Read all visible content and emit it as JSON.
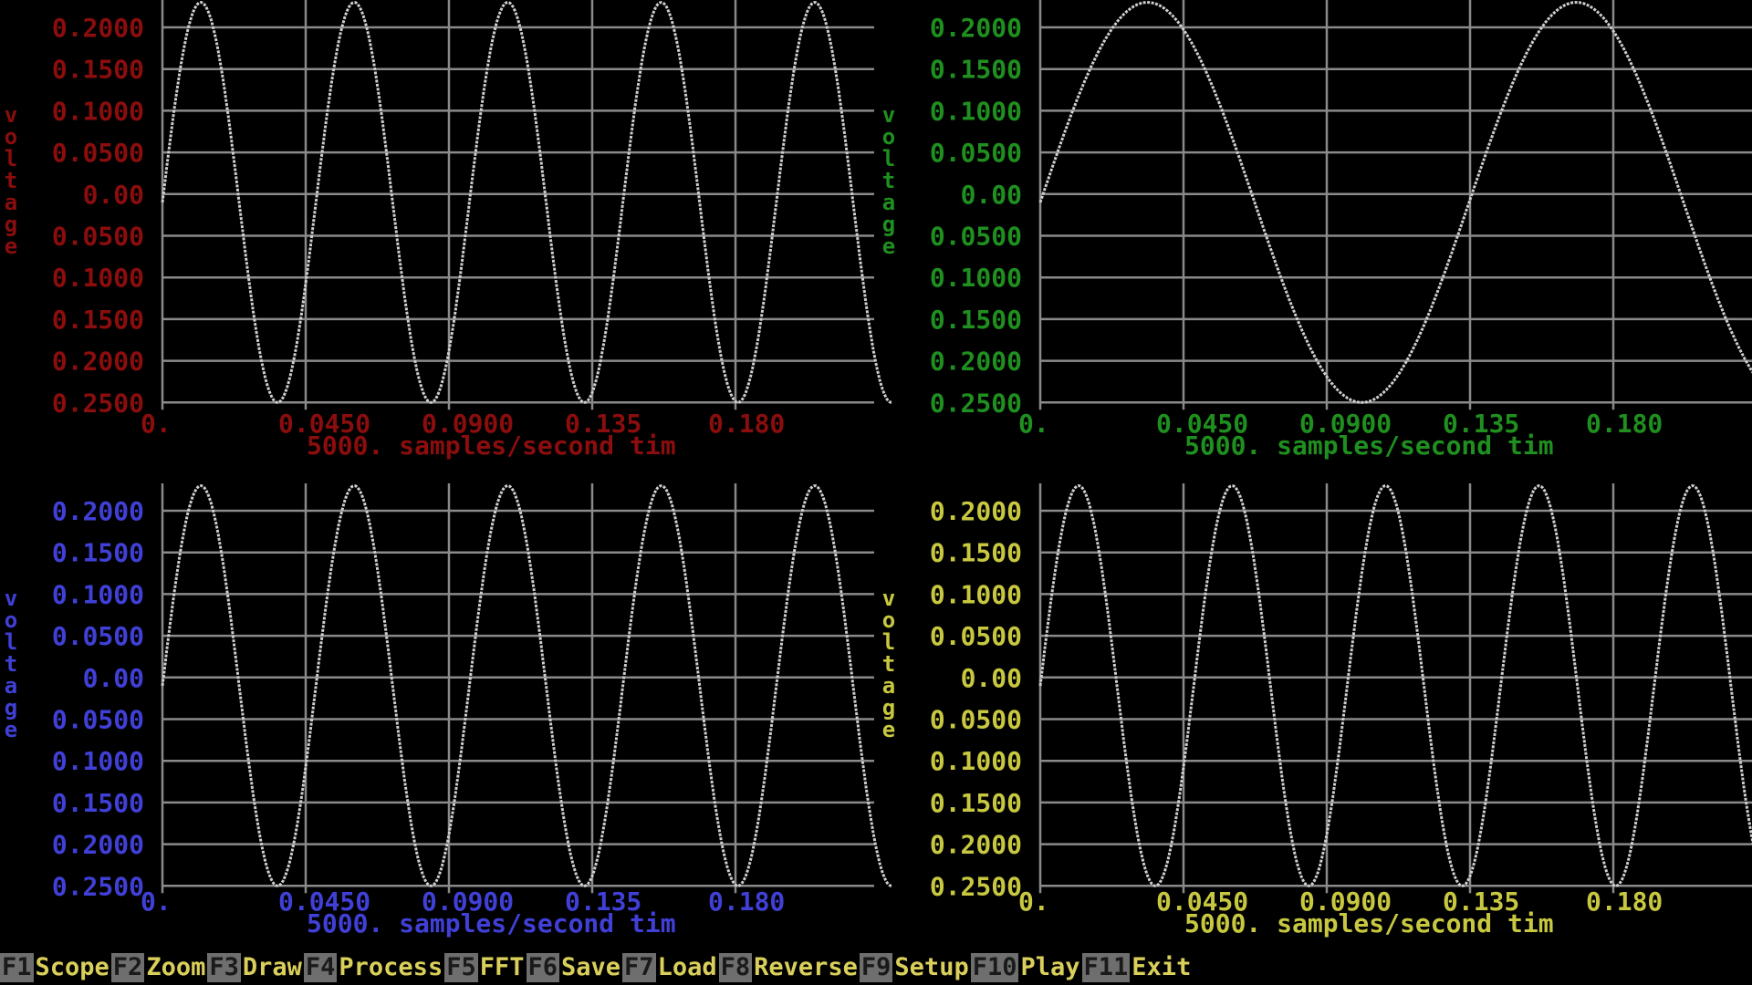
{
  "colors": {
    "background": "#000000",
    "grid": "#8a8a8a",
    "trace": "#cfcfcf",
    "fkey_label": "#d9cf5a",
    "fkey_box": "#6e6e6e"
  },
  "panels": [
    {
      "id": "ch1",
      "color": "#8b0d0d",
      "y_axis_title": "voltage",
      "y_ticks": [
        "0.2000",
        "0.1500",
        "0.1000",
        "0.0500",
        "0.00",
        "0.0500",
        "0.1000",
        "0.1500",
        "0.2000",
        "0.2500"
      ],
      "x_ticks": [
        "0.",
        "0.0450",
        "0.0900",
        "0.135",
        "0.180"
      ],
      "footer": "5000. samples/second  tim"
    },
    {
      "id": "ch2",
      "color": "#1f8f1f",
      "y_axis_title": "voltage",
      "y_ticks": [
        "0.2000",
        "0.1500",
        "0.1000",
        "0.0500",
        "0.00",
        "0.0500",
        "0.1000",
        "0.1500",
        "0.2000",
        "0.2500"
      ],
      "x_ticks": [
        "0.",
        "0.0450",
        "0.0900",
        "0.135",
        "0.180"
      ],
      "footer": "5000. samples/second  tim"
    },
    {
      "id": "ch3",
      "color": "#4040d8",
      "y_axis_title": "voltage",
      "y_ticks": [
        "0.2000",
        "0.1500",
        "0.1000",
        "0.0500",
        "0.00",
        "0.0500",
        "0.1000",
        "0.1500",
        "0.2000",
        "0.2500"
      ],
      "x_ticks": [
        "0.",
        "0.0450",
        "0.0900",
        "0.135",
        "0.180"
      ],
      "footer": "5000. samples/second  tim"
    },
    {
      "id": "ch4",
      "color": "#c8c840",
      "y_axis_title": "voltage",
      "y_ticks": [
        "0.2000",
        "0.1500",
        "0.1000",
        "0.0500",
        "0.00",
        "0.0500",
        "0.1000",
        "0.1500",
        "0.2000",
        "0.2500"
      ],
      "x_ticks": [
        "0.",
        "0.0450",
        "0.0900",
        "0.135",
        "0.180"
      ],
      "footer": "5000. samples/second  tim"
    }
  ],
  "chart_data": [
    {
      "type": "line",
      "series": [
        {
          "amplitude": 0.24,
          "cycles": 4.75,
          "t_end": 0.229,
          "offset": -0.01
        }
      ],
      "x_ticks": [
        0,
        0.045,
        0.09,
        0.135,
        0.18
      ],
      "ylim": [
        -0.25,
        0.2
      ],
      "grid": true
    },
    {
      "type": "line",
      "series": [
        {
          "amplitude": 0.24,
          "cycles": 1.7,
          "t_end": 0.229,
          "offset": -0.01
        }
      ],
      "x_ticks": [
        0,
        0.045,
        0.09,
        0.135,
        0.18
      ],
      "ylim": [
        -0.25,
        0.2
      ],
      "grid": true
    },
    {
      "type": "line",
      "series": [
        {
          "amplitude": 0.24,
          "cycles": 4.75,
          "t_end": 0.229,
          "offset": -0.01
        }
      ],
      "x_ticks": [
        0,
        0.045,
        0.09,
        0.135,
        0.18
      ],
      "ylim": [
        -0.25,
        0.2
      ],
      "grid": true
    },
    {
      "type": "line",
      "series": [
        {
          "amplitude": 0.24,
          "cycles": 4.75,
          "t_end": 0.229,
          "offset": -0.01
        }
      ],
      "x_ticks": [
        0,
        0.045,
        0.09,
        0.135,
        0.18
      ],
      "ylim": [
        -0.25,
        0.2
      ],
      "grid": true
    }
  ],
  "function_keys": [
    {
      "key": "F1",
      "label": "Scope"
    },
    {
      "key": "F2",
      "label": "Zoom"
    },
    {
      "key": "F3",
      "label": "Draw"
    },
    {
      "key": "F4",
      "label": "Process"
    },
    {
      "key": "F5",
      "label": "FFT"
    },
    {
      "key": "F6",
      "label": "Save"
    },
    {
      "key": "F7",
      "label": "Load"
    },
    {
      "key": "F8",
      "label": "Reverse"
    },
    {
      "key": "F9",
      "label": "Setup"
    },
    {
      "key": "F10",
      "label": "Play"
    },
    {
      "key": "F11",
      "label": "Exit"
    }
  ]
}
